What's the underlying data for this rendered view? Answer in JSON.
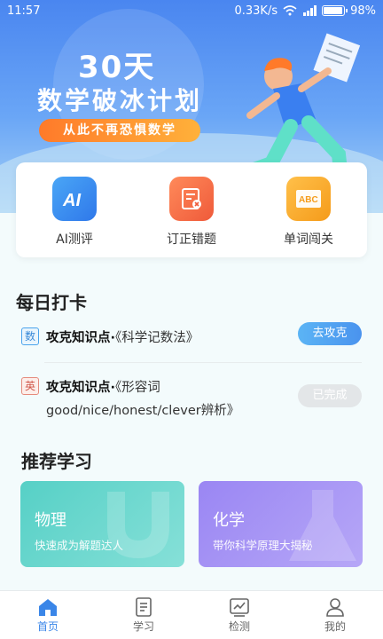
{
  "status_bar": {
    "time": "11:57",
    "network_speed": "0.33K/s",
    "battery": "98%"
  },
  "banner": {
    "title_line1": "30天",
    "title_line2": "数学破冰计划",
    "subtitle": "从此不再恐惧数学"
  },
  "tools": [
    {
      "label": "AI测评",
      "icon": "ai-assessment-icon",
      "color": "#3a8ef0"
    },
    {
      "label": "订正错题",
      "icon": "error-correction-icon",
      "color": "#f06a4a"
    },
    {
      "label": "单词闯关",
      "icon": "word-challenge-icon",
      "color": "#f5a623"
    }
  ],
  "daily": {
    "title": "每日打卡",
    "items": [
      {
        "tag": "数",
        "prefix": "攻克知识点·",
        "topic": "《科学记数法》",
        "action": "去攻克"
      },
      {
        "tag": "英",
        "prefix": "攻克知识点·",
        "topic": "《形容词good/nice/honest/clever辨析》",
        "action": "已完成"
      }
    ]
  },
  "recommend": {
    "title": "推荐学习",
    "cards": [
      {
        "title": "物理",
        "subtitle": "快速成为解题达人"
      },
      {
        "title": "化学",
        "subtitle": "带你科学原理大揭秘"
      }
    ]
  },
  "nav": [
    {
      "label": "首页",
      "icon": "home-icon",
      "active": true
    },
    {
      "label": "学习",
      "icon": "study-icon",
      "active": false
    },
    {
      "label": "检测",
      "icon": "test-icon",
      "active": false
    },
    {
      "label": "我的",
      "icon": "profile-icon",
      "active": false
    }
  ]
}
